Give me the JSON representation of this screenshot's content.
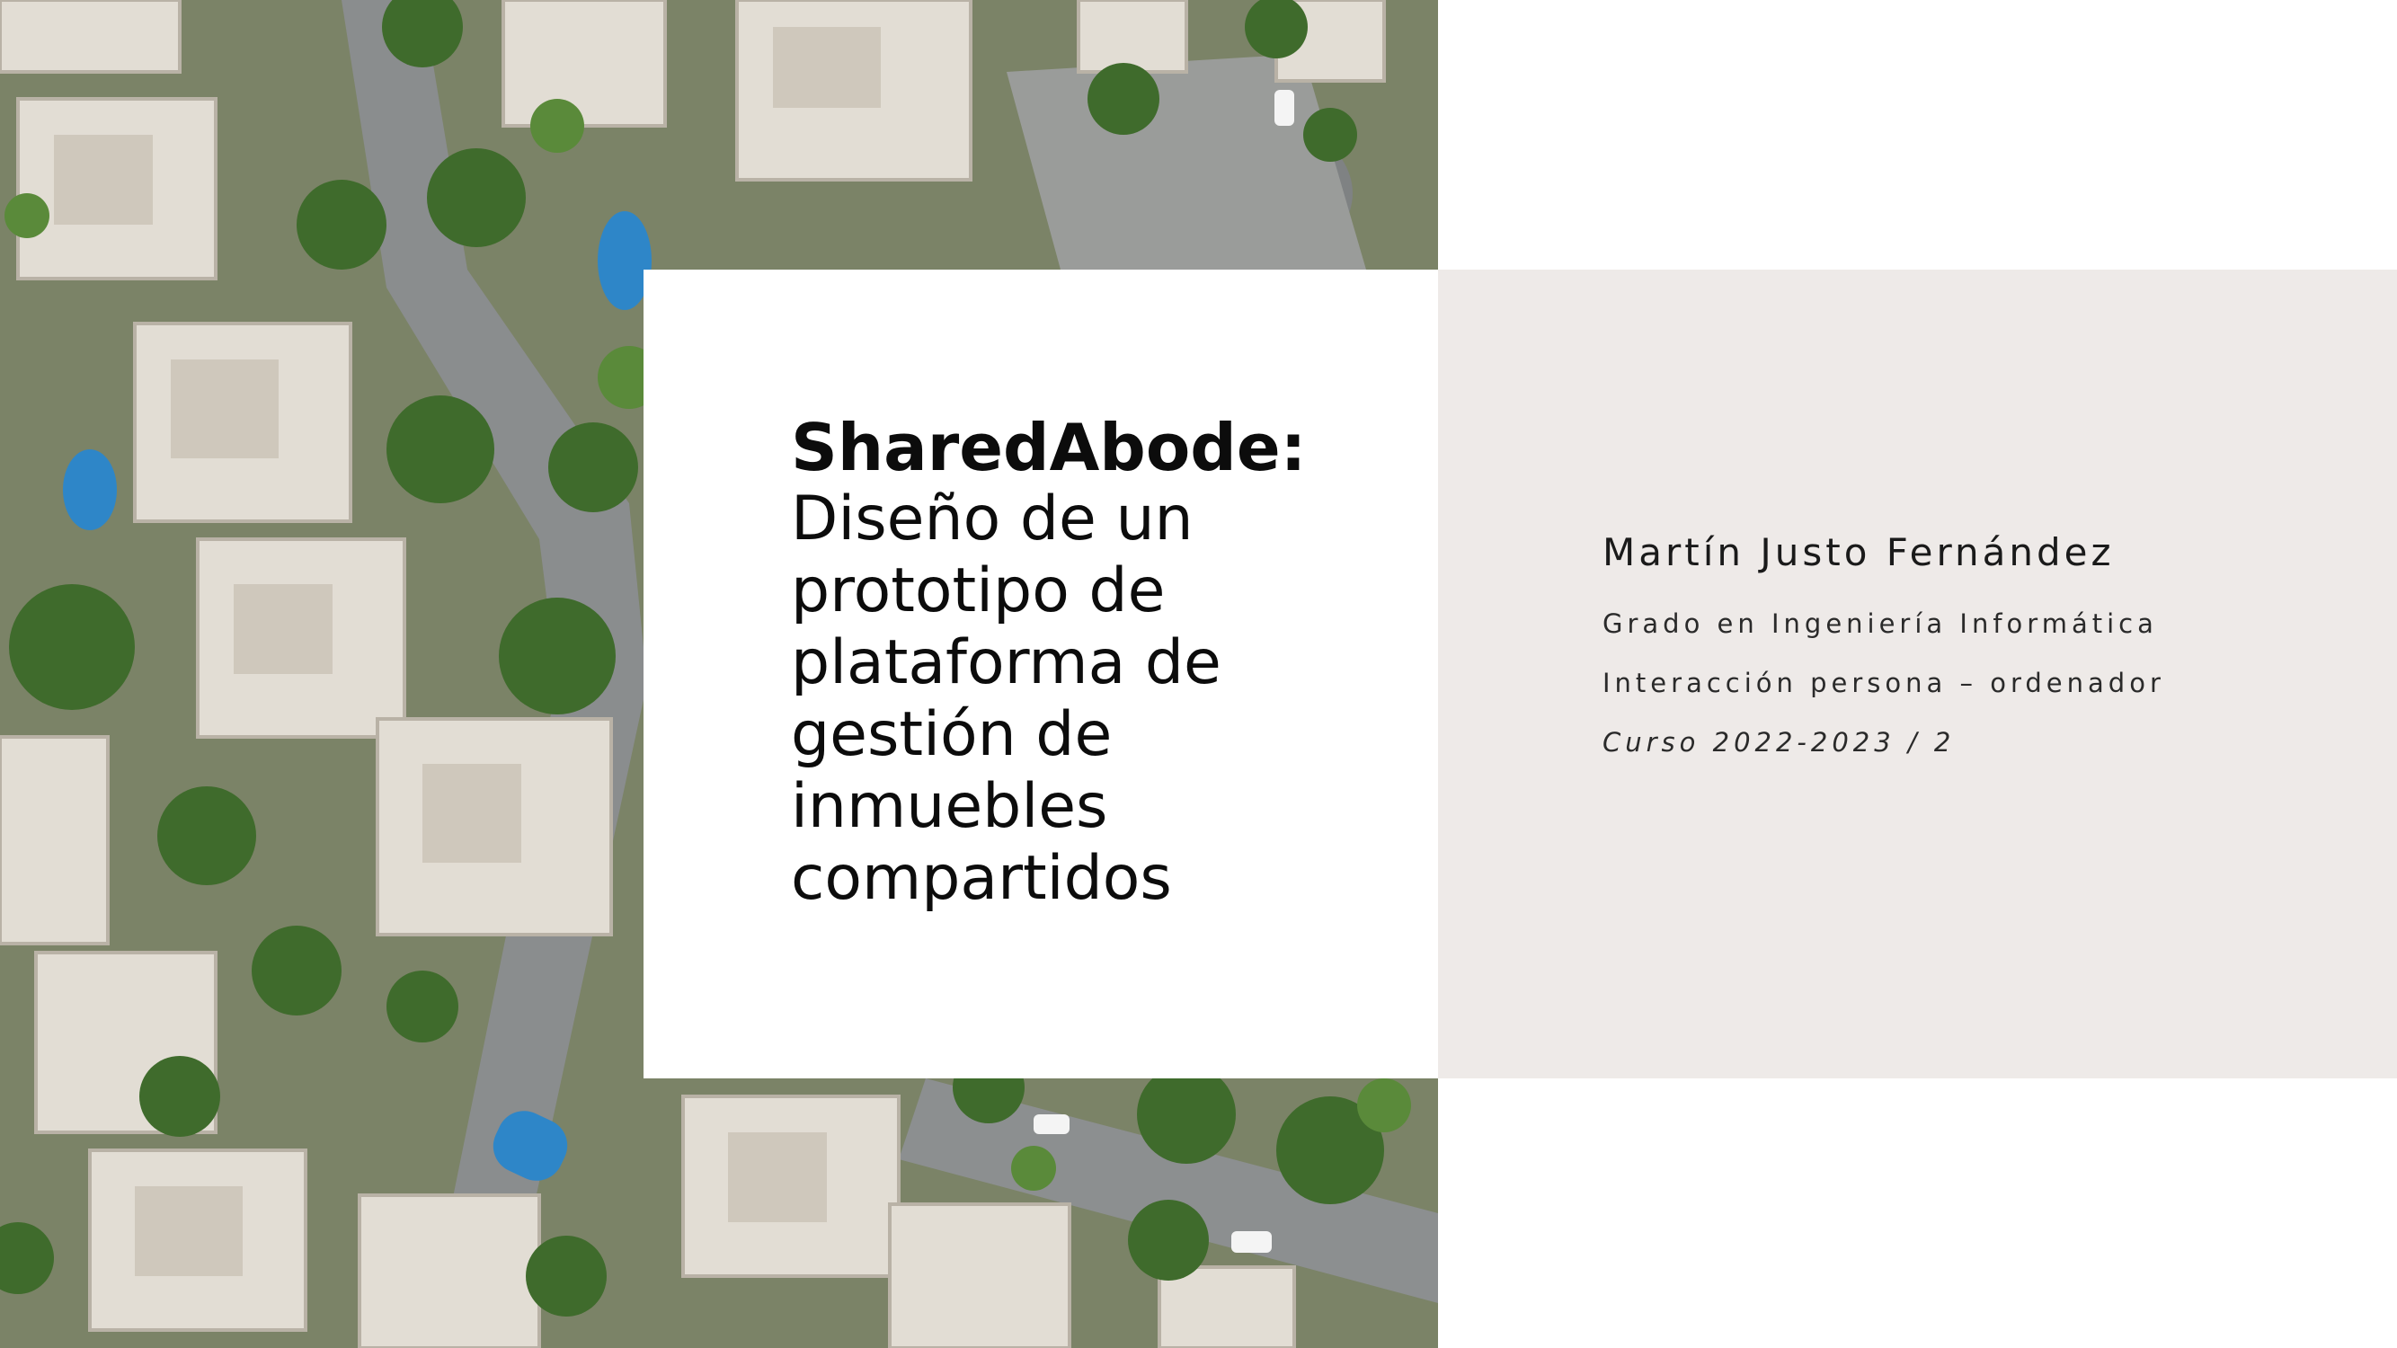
{
  "slide": {
    "title_strong": "SharedAbode:",
    "title_sub": "Diseño de un\nprototipo de\nplataforma de\ngestión de\ninmuebles\ncompartidos"
  },
  "author": {
    "name": "Martín Justo Fernández",
    "degree": "Grado en Ingeniería Informática",
    "course": "Interacción persona – ordenador",
    "year": "Curso 2022-2023 / 2"
  },
  "photo": {
    "description_icon": "aerial-neighborhood-photo"
  },
  "colors": {
    "panel_grey": "#eeeae8",
    "text": "#0c0c0c"
  }
}
